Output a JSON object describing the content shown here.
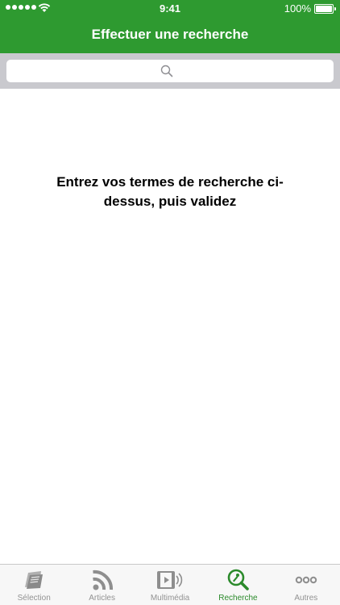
{
  "status_bar": {
    "time": "9:41",
    "battery": "100%"
  },
  "header": {
    "title": "Effectuer une recherche"
  },
  "search": {
    "placeholder": "",
    "value": ""
  },
  "main": {
    "message": "Entrez vos termes de recherche ci-dessus, puis validez"
  },
  "tabbar": {
    "active": "Recherche",
    "items": [
      {
        "label": "Sélection",
        "icon": "newspaper-icon"
      },
      {
        "label": "Articles",
        "icon": "rss-icon"
      },
      {
        "label": "Multimédia",
        "icon": "film-icon"
      },
      {
        "label": "Recherche",
        "icon": "magnifier-icon"
      },
      {
        "label": "Autres",
        "icon": "more-dots-icon"
      }
    ]
  },
  "colors": {
    "brand": "#2e9a30",
    "active_tab": "#2b8a2b",
    "inactive_tab": "#929292"
  }
}
